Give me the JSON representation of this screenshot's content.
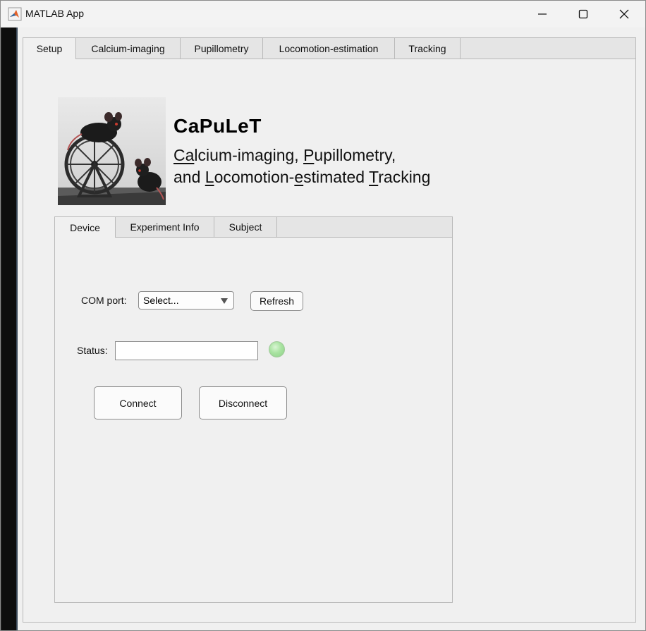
{
  "window": {
    "title": "MATLAB App",
    "controls": [
      "minimize-icon",
      "maximize-icon",
      "close-icon"
    ]
  },
  "main_tabs": [
    {
      "label": "Setup",
      "active": true
    },
    {
      "label": "Calcium-imaging",
      "active": false
    },
    {
      "label": "Pupillometry",
      "active": false
    },
    {
      "label": "Locomotion-estimation",
      "active": false
    },
    {
      "label": "Tracking",
      "active": false
    }
  ],
  "header": {
    "app_name": "CaPuLeT",
    "subtitle_line1": "Calcium-imaging, Pupillometry,",
    "subtitle_line2": "and Locomotion-estimated Tracking"
  },
  "sub_tabs": [
    {
      "label": "Device",
      "active": true
    },
    {
      "label": "Experiment Info",
      "active": false
    },
    {
      "label": "Subject",
      "active": false
    }
  ],
  "device": {
    "com_port_label": "COM port:",
    "com_port_value": "Select...",
    "refresh_label": "Refresh",
    "status_label": "Status:",
    "status_value": "",
    "status_lamp_color": "#a9e3a1",
    "connect_label": "Connect",
    "disconnect_label": "Disconnect"
  }
}
